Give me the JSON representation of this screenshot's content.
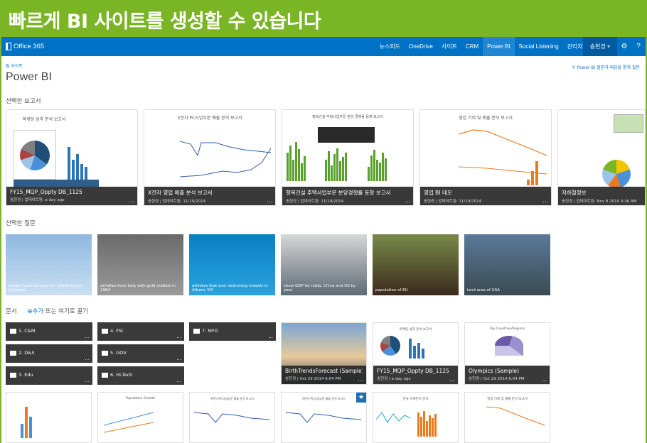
{
  "banner": {
    "title": "빠르게 BI 사이트를 생성할 수 있습니다"
  },
  "suitebar": {
    "app_name": "Office 365",
    "nav": [
      "뉴스피드",
      "OneDrive",
      "사이트",
      "CRM",
      "Power BI",
      "Social Listening",
      "관리자 ▾"
    ],
    "active_nav": "Power BI",
    "user": "송헌경",
    "icons": [
      "chevron-down-icon",
      "gear-icon",
      "help-icon"
    ]
  },
  "breadcrumb": "팀 사이트",
  "page_title": "Power BI",
  "help_link": "Power BI 질문과 대답을 통해 질문",
  "sections": {
    "reports": "선택한 보고서",
    "questions": "선택한 질문",
    "documents": "문서",
    "add_link": "⊕추가",
    "drag_text": " 또는 여기로 끌기"
  },
  "reports": [
    {
      "title": "FY15_MQP_Oppty DB_1125",
      "sub": "송헌경 | 업데이트됨: a day ago",
      "thumb_title": "마케팅 성과 분석 보고서"
    },
    {
      "title": "X전자 영업 매출 분석 보고서",
      "sub": "송헌경 | 업데이트됨: 11/19/2014",
      "thumb_title": "X전자 PC사업부문 매출 분석 보고서"
    },
    {
      "title": "행복건설 주택사업부문 분양경쟁률 동향 보고서",
      "sub": "송헌경 | 업데이트됨: 11/19/2014",
      "thumb_title": "행복건설 주택사업부문 분양 경쟁률 동향 보고서"
    },
    {
      "title": "영업 BI 데모",
      "sub": "송헌경 | 업데이트됨: 11/19/2014",
      "thumb_title": "영업 기회 및 매출 분석 보고서"
    },
    {
      "title": "지하철정보",
      "sub": "송헌경 | 업데이트됨: Nov 8 2014 3:36 AM",
      "thumb_title": ""
    }
  ],
  "questions": [
    {
      "text": "medal count by year for swimming vs athletics"
    },
    {
      "text": "athletes from italy with gold medals in 1964"
    },
    {
      "text": "athletes that won swimming medals in Athens '04"
    },
    {
      "text": "show GDP for india, China and US by year"
    },
    {
      "text": "population of EU"
    },
    {
      "text": "land area of USA"
    }
  ],
  "folders": [
    {
      "label": "1. C&M"
    },
    {
      "label": "4. FSI"
    },
    {
      "label": "7. MFG"
    },
    {
      "label": "2. D&S"
    },
    {
      "label": "5. GOV"
    },
    {
      "label": "3. Edu"
    },
    {
      "label": "6. Hi-Tech"
    }
  ],
  "doc_cards": [
    {
      "title": "BirthTrendsForecast (Sample)",
      "sub": "송헌경 | Oct 29 2014 6:04 PM"
    },
    {
      "title": "FY15_MQP_Oppty DB_1125",
      "sub": "송헌경 | a day ago",
      "thumb_title": "마케팅 성과 분석 보고서"
    },
    {
      "title": "Olympics (Sample)",
      "sub": "송헌경 | Oct 29 2014 6:04 PM",
      "thumb_title": "Top Countries/Regions"
    }
  ],
  "bottom_cards": [
    {
      "thumb_title": ""
    },
    {
      "thumb_title": "Population Growth"
    },
    {
      "thumb_title": "X전자 PC사업부문 매출 분석 보고서"
    },
    {
      "thumb_title": "X전자 PC사업부문 매출 분석 보고서"
    },
    {
      "thumb_title": "전국 미세먼지 분석"
    },
    {
      "thumb_title": "영업 기회 및 매출 분석 보고서"
    }
  ],
  "more_glyph": "...",
  "colors": {
    "banner": "#7ab526",
    "suitebar": "#0072c6",
    "caption": "#282828"
  }
}
